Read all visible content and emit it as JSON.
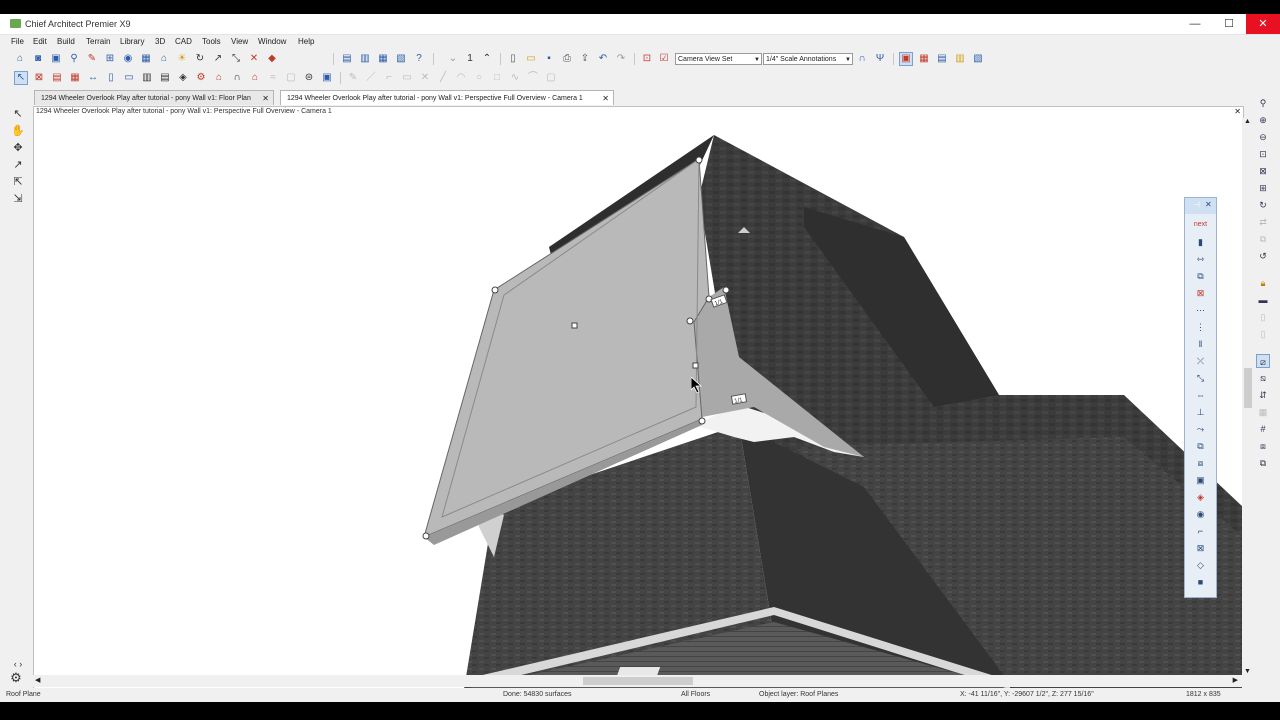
{
  "app": {
    "title": "Chief Architect Premier X9"
  },
  "window_controls": {
    "minimize": "—",
    "maximize": "☐",
    "close": "✕"
  },
  "menu": [
    "File",
    "Edit",
    "Build",
    "Terrain",
    "Library",
    "3D",
    "CAD",
    "Tools",
    "View",
    "Window",
    "Help"
  ],
  "toolbar": {
    "counter_value": "1",
    "camera_view_set": "Camera View Set",
    "scale_annotations": "1/4\" Scale Annotations"
  },
  "tabs": [
    {
      "label": "1294 Wheeler Overlook Play after tutorial - pony Wall v1: Floor Plan",
      "active": false
    },
    {
      "label": "1294 Wheeler Overlook Play after tutorial - pony Wall v1: Perspective Full Overview - Camera 1",
      "active": true
    }
  ],
  "viewport": {
    "title": "1294 Wheeler Overlook Play after tutorial - pony Wall v1: Perspective Full Overview - Camera 1",
    "edge_labels": [
      "1/1",
      "1/1"
    ]
  },
  "palette": {
    "next_label": "next"
  },
  "status": {
    "selected_object": "Roof Plane",
    "render_status": "Done:  54830 surfaces",
    "floor": "All Floors",
    "object_layer": "Object layer: Roof Planes",
    "coordinates": "X: -41 11/16\", Y: -29607 1/2\", Z: 277 15/16\"",
    "resolution": "1812 x 835"
  },
  "colors": {
    "roof_dark": "#3a3a3a",
    "roof_selected": "#b8b8b8",
    "accent_close": "#e81123",
    "palette_border": "#9db4d0"
  }
}
